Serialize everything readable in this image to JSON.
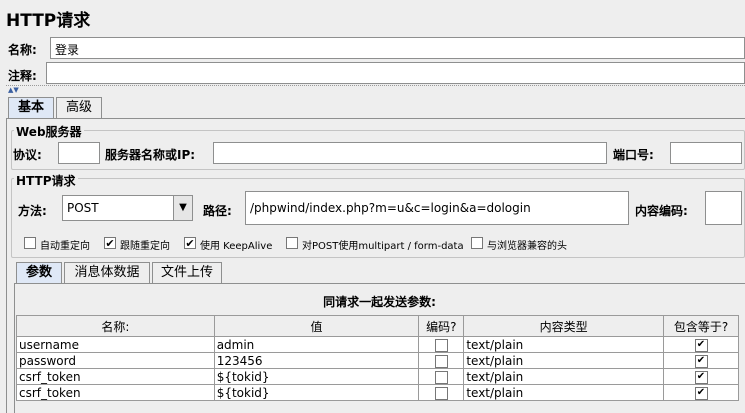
{
  "panel": {
    "title": "HTTP请求"
  },
  "name_row": {
    "label": "名称:",
    "value": "登录"
  },
  "comment_row": {
    "label": "注释:",
    "value": ""
  },
  "main_tabs": [
    {
      "label": "基本",
      "selected": true
    },
    {
      "label": "高级",
      "selected": false
    }
  ],
  "web_server": {
    "legend": "Web服务器",
    "protocol_label": "协议:",
    "protocol_value": "",
    "server_label": "服务器名称或IP:",
    "server_value": "",
    "port_label": "端口号:",
    "port_value": ""
  },
  "http_request": {
    "legend": "HTTP请求",
    "method_label": "方法:",
    "method_value": "POST",
    "path_label": "路径:",
    "path_value": "/phpwind/index.php?m=u&c=login&a=dologin",
    "encoding_label": "内容编码:",
    "encoding_value": ""
  },
  "options": [
    {
      "label": "自动重定向",
      "checked": false
    },
    {
      "label": "跟随重定向",
      "checked": true
    },
    {
      "label": "使用 KeepAlive",
      "checked": true
    },
    {
      "label": "对POST使用multipart / form-data",
      "checked": false
    },
    {
      "label": "与浏览器兼容的头",
      "checked": false
    }
  ],
  "sub_tabs": [
    {
      "label": "参数",
      "selected": true
    },
    {
      "label": "消息体数据",
      "selected": false
    },
    {
      "label": "文件上传",
      "selected": false
    }
  ],
  "params": {
    "title": "同请求一起发送参数:",
    "columns": [
      "名称:",
      "值",
      "编码?",
      "内容类型",
      "包含等于?"
    ],
    "rows": [
      {
        "name": "username",
        "value": "admin",
        "encode": false,
        "content_type": "text/plain",
        "include_equals": true
      },
      {
        "name": "password",
        "value": "123456",
        "encode": false,
        "content_type": "text/plain",
        "include_equals": true
      },
      {
        "name": "csrf_token",
        "value": "${tokid}",
        "encode": false,
        "content_type": "text/plain",
        "include_equals": true
      },
      {
        "name": "csrf_token",
        "value": "${tokid}",
        "encode": false,
        "content_type": "text/plain",
        "include_equals": true
      }
    ]
  },
  "colors": {
    "tab_selected_bg": "#dfe8f6",
    "panel_bg": "#eeeeee",
    "border": "#8e8f8f"
  }
}
